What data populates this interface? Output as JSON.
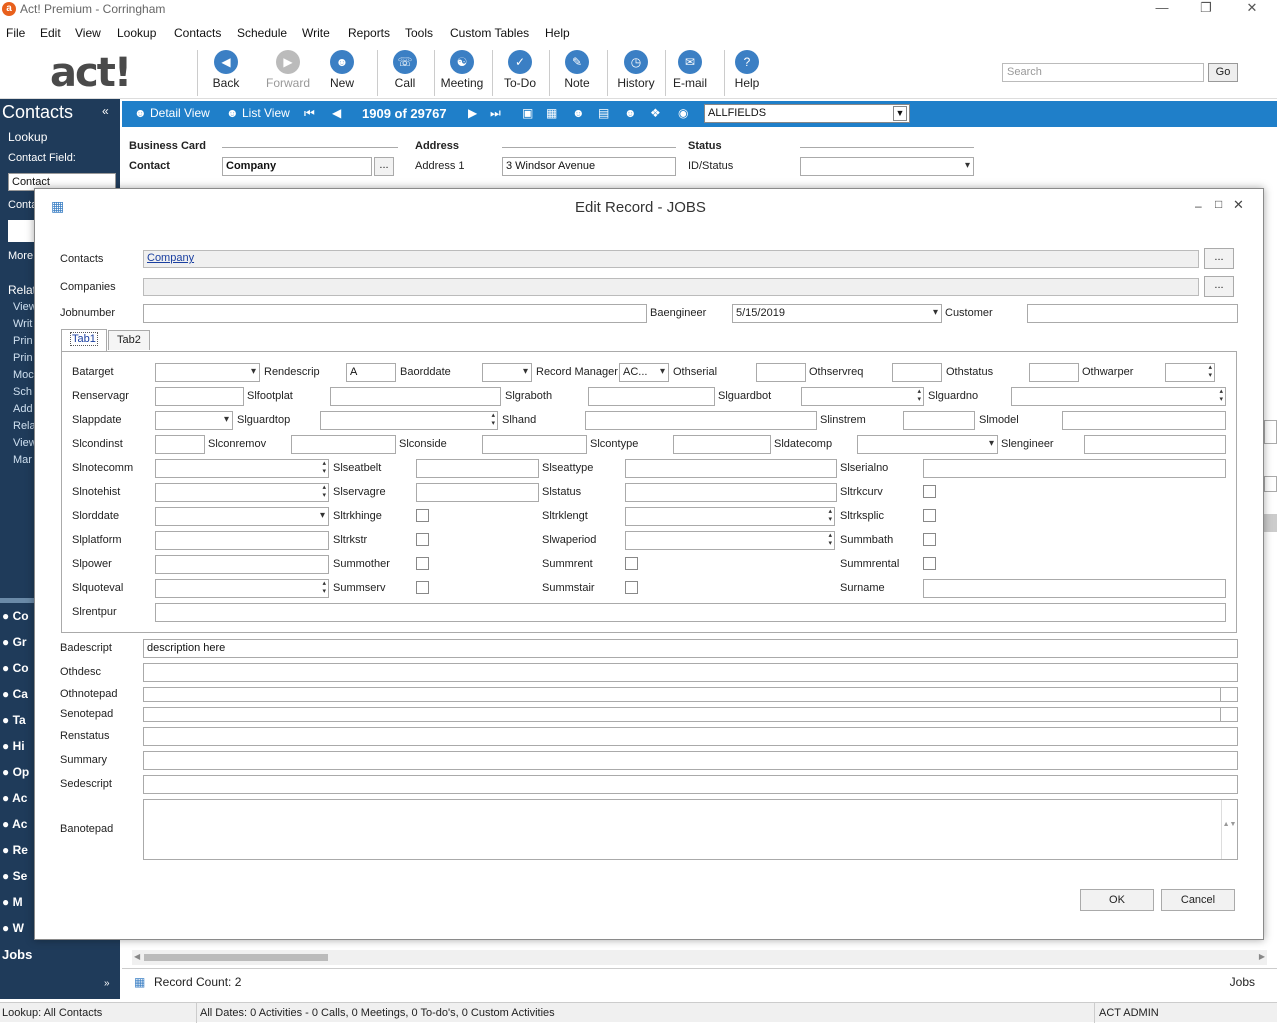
{
  "window": {
    "title": "Act! Premium - Corringham",
    "app_icon": "a"
  },
  "menu": [
    "File",
    "Edit",
    "View",
    "Lookup",
    "Contacts",
    "Schedule",
    "Write",
    "Reports",
    "Tools",
    "Custom Tables",
    "Help"
  ],
  "logo": "act!",
  "toolbar": {
    "buttons": [
      {
        "label": "Back",
        "icon": "back-icon"
      },
      {
        "label": "Forward",
        "icon": "forward-icon"
      },
      {
        "label": "New",
        "icon": "new-contact-icon"
      },
      {
        "label": "Call",
        "icon": "phone-icon"
      },
      {
        "label": "Meeting",
        "icon": "handshake-icon"
      },
      {
        "label": "To-Do",
        "icon": "todo-icon"
      },
      {
        "label": "Note",
        "icon": "note-icon"
      },
      {
        "label": "History",
        "icon": "history-icon"
      },
      {
        "label": "E-mail",
        "icon": "email-icon"
      },
      {
        "label": "Help",
        "icon": "help-icon"
      }
    ],
    "search_placeholder": "Search",
    "go_label": "Go"
  },
  "sidebar": {
    "header": "Contacts",
    "lookup": "Lookup",
    "contact_field_label": "Contact Field:",
    "contact_field_value": "Contact",
    "conta_label": "Conta",
    "more": "More",
    "related_label": "Relat",
    "related_items": [
      "View",
      "Writ",
      "Prin",
      "Prin",
      "Moc",
      "Sch",
      "Add",
      "Rela",
      "View",
      "Mar"
    ],
    "nav": [
      "Co",
      "Gr",
      "Co",
      "Ca",
      "Ta",
      "Hi",
      "Op",
      "Ac",
      "Ac",
      "Re",
      "Se",
      "M",
      "W"
    ],
    "jobs": "Jobs"
  },
  "record_bar": {
    "detail_view": "Detail View",
    "list_view": "List View",
    "record_counter": "1909 of 29767",
    "layout_select": "ALLFIELDS"
  },
  "business_card": {
    "section1": "Business Card",
    "section2": "Address",
    "section3": "Status",
    "contact_label": "Contact",
    "contact_value": "Company",
    "address1_label": "Address 1",
    "address1_value": "3 Windsor Avenue",
    "idstatus_label": "ID/Status",
    "browse": "..."
  },
  "dialog": {
    "title": "Edit Record - JOBS",
    "contacts_label": "Contacts",
    "contacts_value": "Company",
    "companies_label": "Companies",
    "jobnumber_label": "Jobnumber",
    "baengineer_label": "Baengineer",
    "baengineer_value": "5/15/2019",
    "customer_label": "Customer",
    "browse": "...",
    "tabs": [
      "Tab1",
      "Tab2"
    ],
    "tab1": {
      "batarget": "Batarget",
      "rendescrip": "Rendescrip",
      "rendescrip_value": "A",
      "baorddate": "Baorddate",
      "record_manager": "Record Manager",
      "record_manager_value": "AC...",
      "othserial": "Othserial",
      "othservreq": "Othservreq",
      "othstatus": "Othstatus",
      "othwarper": "Othwarper",
      "renservagr": "Renservagr",
      "slfootplat": "Slfootplat",
      "slgraboth": "Slgraboth",
      "slguardbot": "Slguardbot",
      "slguardno": "Slguardno",
      "slappdate": "Slappdate",
      "slguardtop": "Slguardtop",
      "slhand": "Slhand",
      "slinstrem": "Slinstrem",
      "slmodel": "Slmodel",
      "slcondinst": "Slcondinst",
      "slconremov": "Slconremov",
      "slconside": "Slconside",
      "slcontype": "Slcontype",
      "sldatecomp": "Sldatecomp",
      "slengineer": "Slengineer",
      "slnotecomm": "Slnotecomm",
      "slseatbelt": "Slseatbelt",
      "slseattype": "Slseattype",
      "slserialno": "Slserialno",
      "slnotehist": "Slnotehist",
      "slservagre": "Slservagre",
      "slstatus": "Slstatus",
      "sltrkcurv": "Sltrkcurv",
      "slorddate": "Slorddate",
      "sltrkhinge": "Sltrkhinge",
      "sltrklengt": "Sltrklengt",
      "sltrksplic": "Sltrksplic",
      "slplatform": "Slplatform",
      "sltrkstr": "Sltrkstr",
      "slwaperiod": "Slwaperiod",
      "summbath": "Summbath",
      "slpower": "Slpower",
      "summother": "Summother",
      "summrent": "Summrent",
      "summrental": "Summrental",
      "slquoteval": "Slquoteval",
      "summserv": "Summserv",
      "summstair": "Summstair",
      "surname": "Surname",
      "slrentpur": "Slrentpur"
    },
    "badescript_label": "Badescript",
    "badescript_value": "description  here",
    "othdesc": "Othdesc",
    "othnotepad": "Othnotepad",
    "senotepad": "Senotepad",
    "renstatus": "Renstatus",
    "summary": "Summary",
    "sedescript": "Sedescript",
    "banotepad": "Banotepad",
    "ok": "OK",
    "cancel": "Cancel"
  },
  "footer": {
    "record_count": "Record Count: 2",
    "jobs": "Jobs"
  },
  "statusbar": {
    "lookup": "Lookup: All Contacts",
    "dates": "All Dates: 0 Activities - 0 Calls, 0 Meetings, 0 To-do's, 0 Custom Activities",
    "user": "ACT ADMIN"
  }
}
